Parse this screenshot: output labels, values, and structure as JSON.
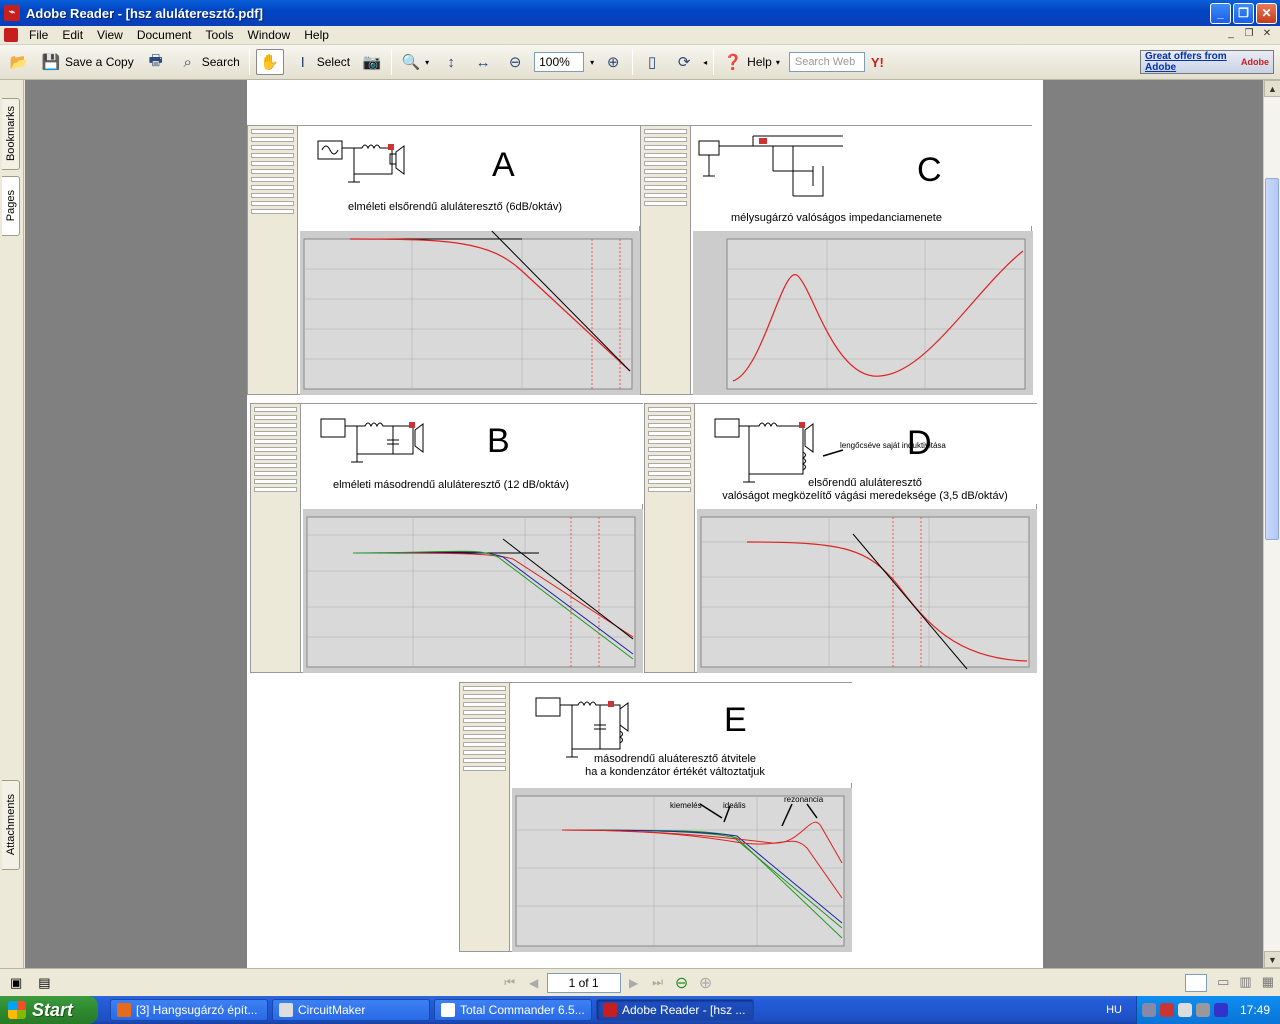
{
  "window": {
    "title": "Adobe Reader - [hsz aluláteresztő.pdf]"
  },
  "menu": [
    "File",
    "Edit",
    "View",
    "Document",
    "Tools",
    "Window",
    "Help"
  ],
  "toolbar": {
    "save_copy": "Save a Copy",
    "search": "Search",
    "select": "Select",
    "zoom": "100%",
    "help": "Help",
    "search_web_placeholder": "Search Web",
    "ad_text": "Great offers from Adobe",
    "ad_logo": "Adobe"
  },
  "leftnav": {
    "bookmarks": "Bookmarks",
    "pages": "Pages",
    "attachments": "Attachments"
  },
  "figures": {
    "A": {
      "letter": "A",
      "caption": "elméleti elsőrendű aluláteresztő (6dB/oktáv)"
    },
    "B": {
      "letter": "B",
      "caption": "elméleti másodrendű aluláteresztő (12 dB/oktáv)"
    },
    "C": {
      "letter": "C",
      "caption": "mélysugárzó valóságos impedanciamenete"
    },
    "D": {
      "letter": "D",
      "caption_line1": "elsőrendű aluláteresztő",
      "caption_line2": "valóságot megközelítő vágási meredeksége (3,5 dB/oktáv)",
      "note": "lengőcséve saját induktivitása"
    },
    "E": {
      "letter": "E",
      "caption_line1": "másodrendű aluáteresztő átvitele",
      "caption_line2": "ha a kondenzátor értékét változtatjuk",
      "label_kiemeles": "kiemelés",
      "label_idealis": "ideális",
      "label_rezonancia": "rezonancia"
    }
  },
  "statusbar": {
    "page": "1 of 1"
  },
  "taskbar": {
    "start": "Start",
    "tasks": [
      "[3] Hangsugárzó épít...",
      "CircuitMaker",
      "Total Commander 6.5...",
      "Adobe Reader - [hsz ..."
    ],
    "lang": "HU",
    "clock": "17:49"
  }
}
